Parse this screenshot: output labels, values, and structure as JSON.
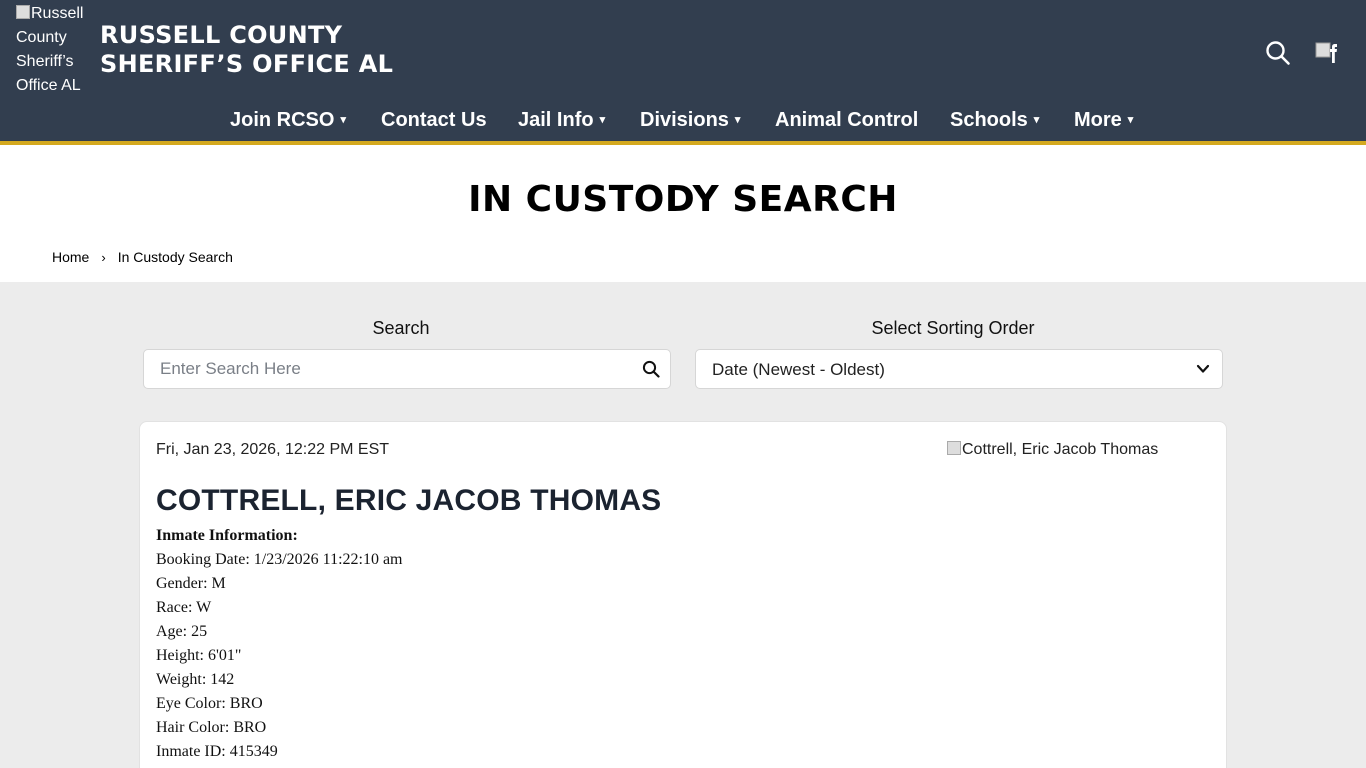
{
  "header": {
    "logo_alt": "Russell County Sheriff’s Office AL",
    "title_line1": "RUSSELL COUNTY",
    "title_line2": "SHERIFF’S OFFICE AL"
  },
  "nav": {
    "items": [
      {
        "label": "Join RCSO",
        "dropdown": true
      },
      {
        "label": "Contact Us",
        "dropdown": false
      },
      {
        "label": "Jail Info",
        "dropdown": true
      },
      {
        "label": "Divisions",
        "dropdown": true
      },
      {
        "label": "Animal Control",
        "dropdown": false
      },
      {
        "label": "Schools",
        "dropdown": true
      },
      {
        "label": "More",
        "dropdown": true
      }
    ],
    "caret": "▾"
  },
  "page": {
    "title": "IN CUSTODY SEARCH"
  },
  "breadcrumb": {
    "home": "Home",
    "separator": "›",
    "current": "In Custody Search"
  },
  "search": {
    "label": "Search",
    "placeholder": "Enter Search Here",
    "value": ""
  },
  "sort": {
    "label": "Select Sorting Order",
    "selected": "Date (Newest - Oldest)"
  },
  "inmate": {
    "date": "Fri, Jan 23, 2026, 12:22 PM EST",
    "image_alt": "Cottrell, Eric Jacob Thomas",
    "name": "COTTRELL, ERIC JACOB THOMAS",
    "info_header": "Inmate Information:",
    "fields": [
      "Booking Date: 1/23/2026 11:22:10 am",
      "Gender: M",
      "Race: W",
      "Age: 25",
      "Height: 6'01\"",
      "Weight: 142",
      "Eye Color: BRO",
      "Hair Color: BRO",
      "Inmate ID: 415349"
    ]
  },
  "colors": {
    "header_bg": "#323e4f",
    "accent_gold": "#d4a91f",
    "page_bg": "#ececec"
  },
  "icons": {
    "search": "search-icon",
    "facebook": "facebook-icon",
    "sort_chevron": "chevron-down-icon"
  }
}
